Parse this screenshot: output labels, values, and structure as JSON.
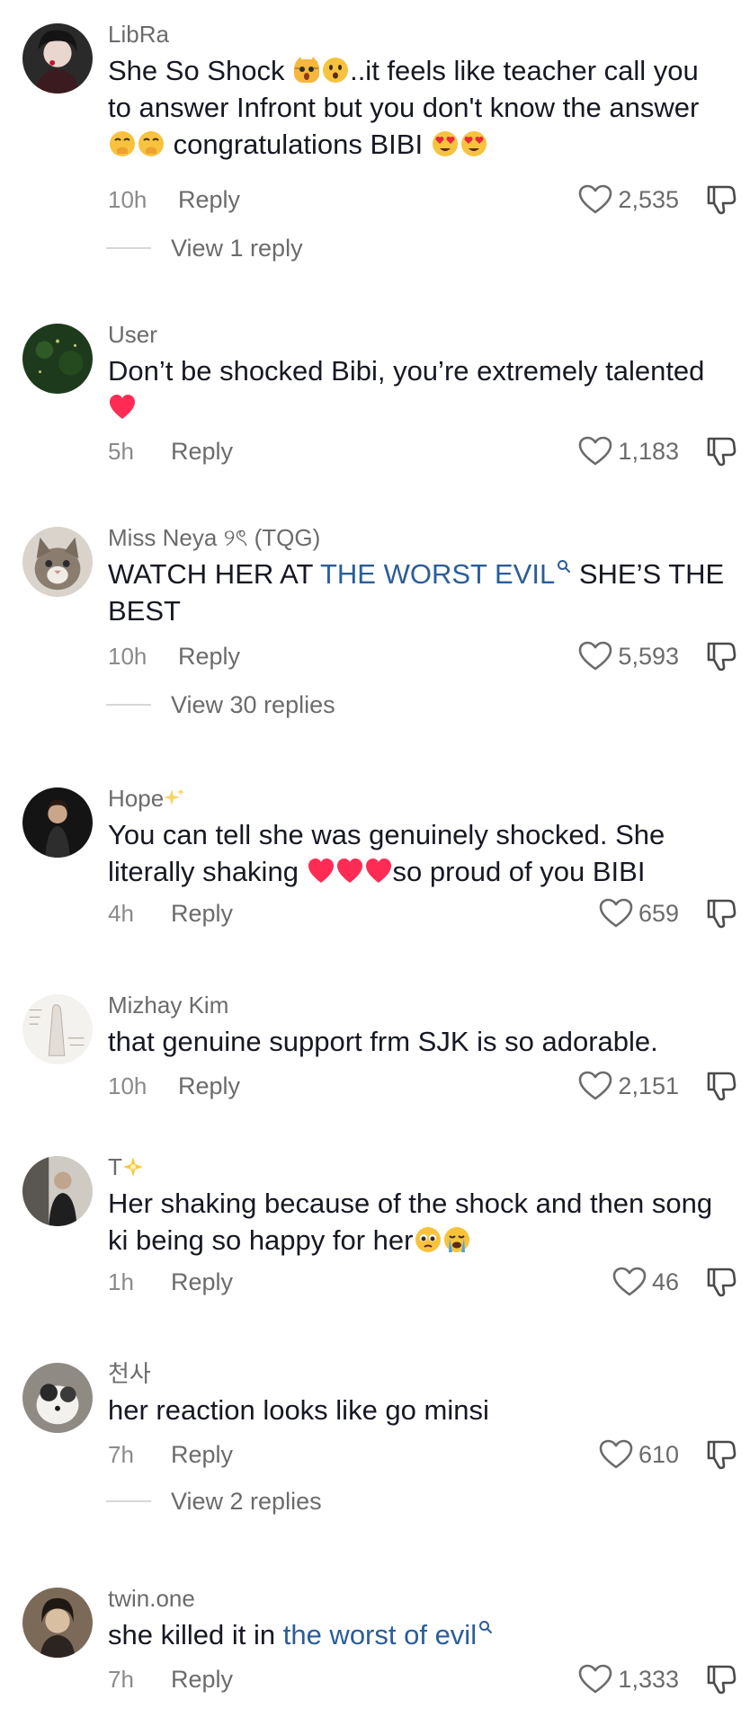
{
  "comments": [
    {
      "username": "LibRa",
      "text_a": "She So Shock ",
      "text_b": "..it feels like teacher call you to answer Infront but you don't know the answer ",
      "text_c": " congratulations BIBI ",
      "time": "10h",
      "reply": "Reply",
      "likes": "2,535",
      "view_replies": "View 1 reply"
    },
    {
      "username": "User",
      "text_a": "Don’t be shocked Bibi, you’re extremely talented ",
      "time": "5h",
      "reply": "Reply",
      "likes": "1,183"
    },
    {
      "username": "Miss Neya ୨ৎ (TQG)",
      "text_a": "WATCH HER AT ",
      "link": "THE WORST EVIL",
      "text_b": " SHE’S THE BEST",
      "time": "10h",
      "reply": "Reply",
      "likes": "5,593",
      "view_replies": "View 30 replies"
    },
    {
      "username": "Hope",
      "text_a": "You can tell she was genuinely shocked. She literally shaking ",
      "text_b": "so proud of you BIBI",
      "time": "4h",
      "reply": "Reply",
      "likes": "659"
    },
    {
      "username": "Mizhay Kim",
      "text_a": "that genuine support frm SJK is so adorable.",
      "time": "10h",
      "reply": "Reply",
      "likes": "2,151"
    },
    {
      "username": "T",
      "text_a": "Her shaking because of the shock and then song ki being so happy for her",
      "time": "1h",
      "reply": "Reply",
      "likes": "46"
    },
    {
      "username": "천사",
      "text_a": "her reaction looks like go minsi",
      "time": "7h",
      "reply": "Reply",
      "likes": "610",
      "view_replies": "View 2 replies"
    },
    {
      "username": "twin.one",
      "text_a": "she killed it in ",
      "link": "the worst of evil",
      "time": "7h",
      "reply": "Reply",
      "likes": "1,333"
    }
  ],
  "colors": {
    "text": "#161823",
    "secondary": "#6b6b6b",
    "link": "#2b5d9a",
    "heart_emoji": "#fe2c55"
  },
  "icons": {
    "like": "heart-outline-icon",
    "dislike": "thumbs-down-icon",
    "search": "search-icon"
  }
}
